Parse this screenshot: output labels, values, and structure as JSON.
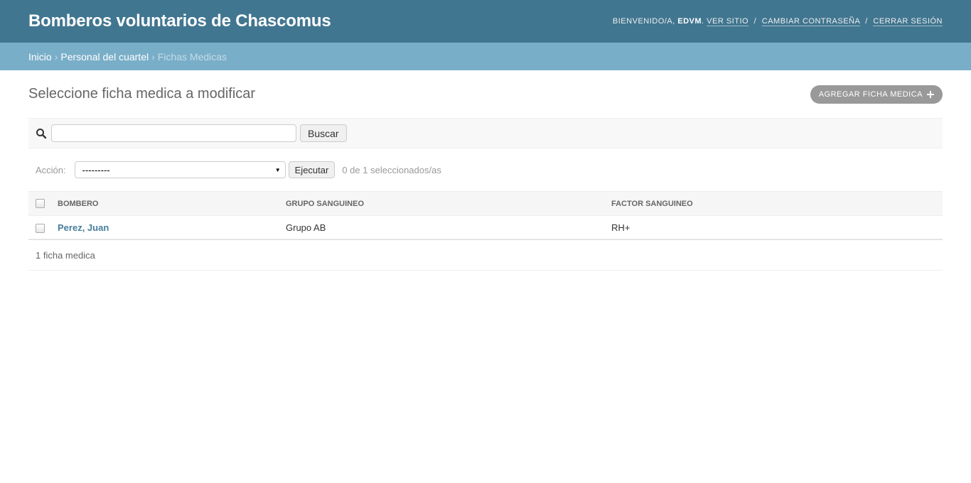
{
  "header": {
    "site_name": "Bomberos voluntarios de Chascomus",
    "welcome": "BIENVENIDO/A,",
    "username": "EDVM",
    "view_site": "VER SITIO",
    "change_password": "CAMBIAR CONTRASEÑA",
    "logout": "CERRAR SESIÓN"
  },
  "breadcrumbs": {
    "home": "Inicio",
    "section": "Personal del cuartel",
    "current": "Fichas Medicas"
  },
  "page": {
    "title": "Seleccione ficha medica a modificar",
    "add_label": "AGREGAR FICHA MEDICA"
  },
  "search": {
    "value": "",
    "button": "Buscar"
  },
  "actions": {
    "label": "Acción:",
    "selected_option": "---------",
    "run_button": "Ejecutar",
    "counter": "0 de 1 seleccionados/as"
  },
  "table": {
    "columns": [
      "BOMBERO",
      "GRUPO SANGUINEO",
      "FACTOR SANGUINEO"
    ],
    "rows": [
      {
        "bombero": "Perez, Juan",
        "grupo": "Grupo AB",
        "factor": "RH+"
      }
    ]
  },
  "paginator": {
    "text": "1 ficha medica"
  },
  "colors": {
    "header_bg": "#417690",
    "breadcrumbs_bg": "#79aec8",
    "link": "#447e9b",
    "add_button_bg": "#999999"
  }
}
